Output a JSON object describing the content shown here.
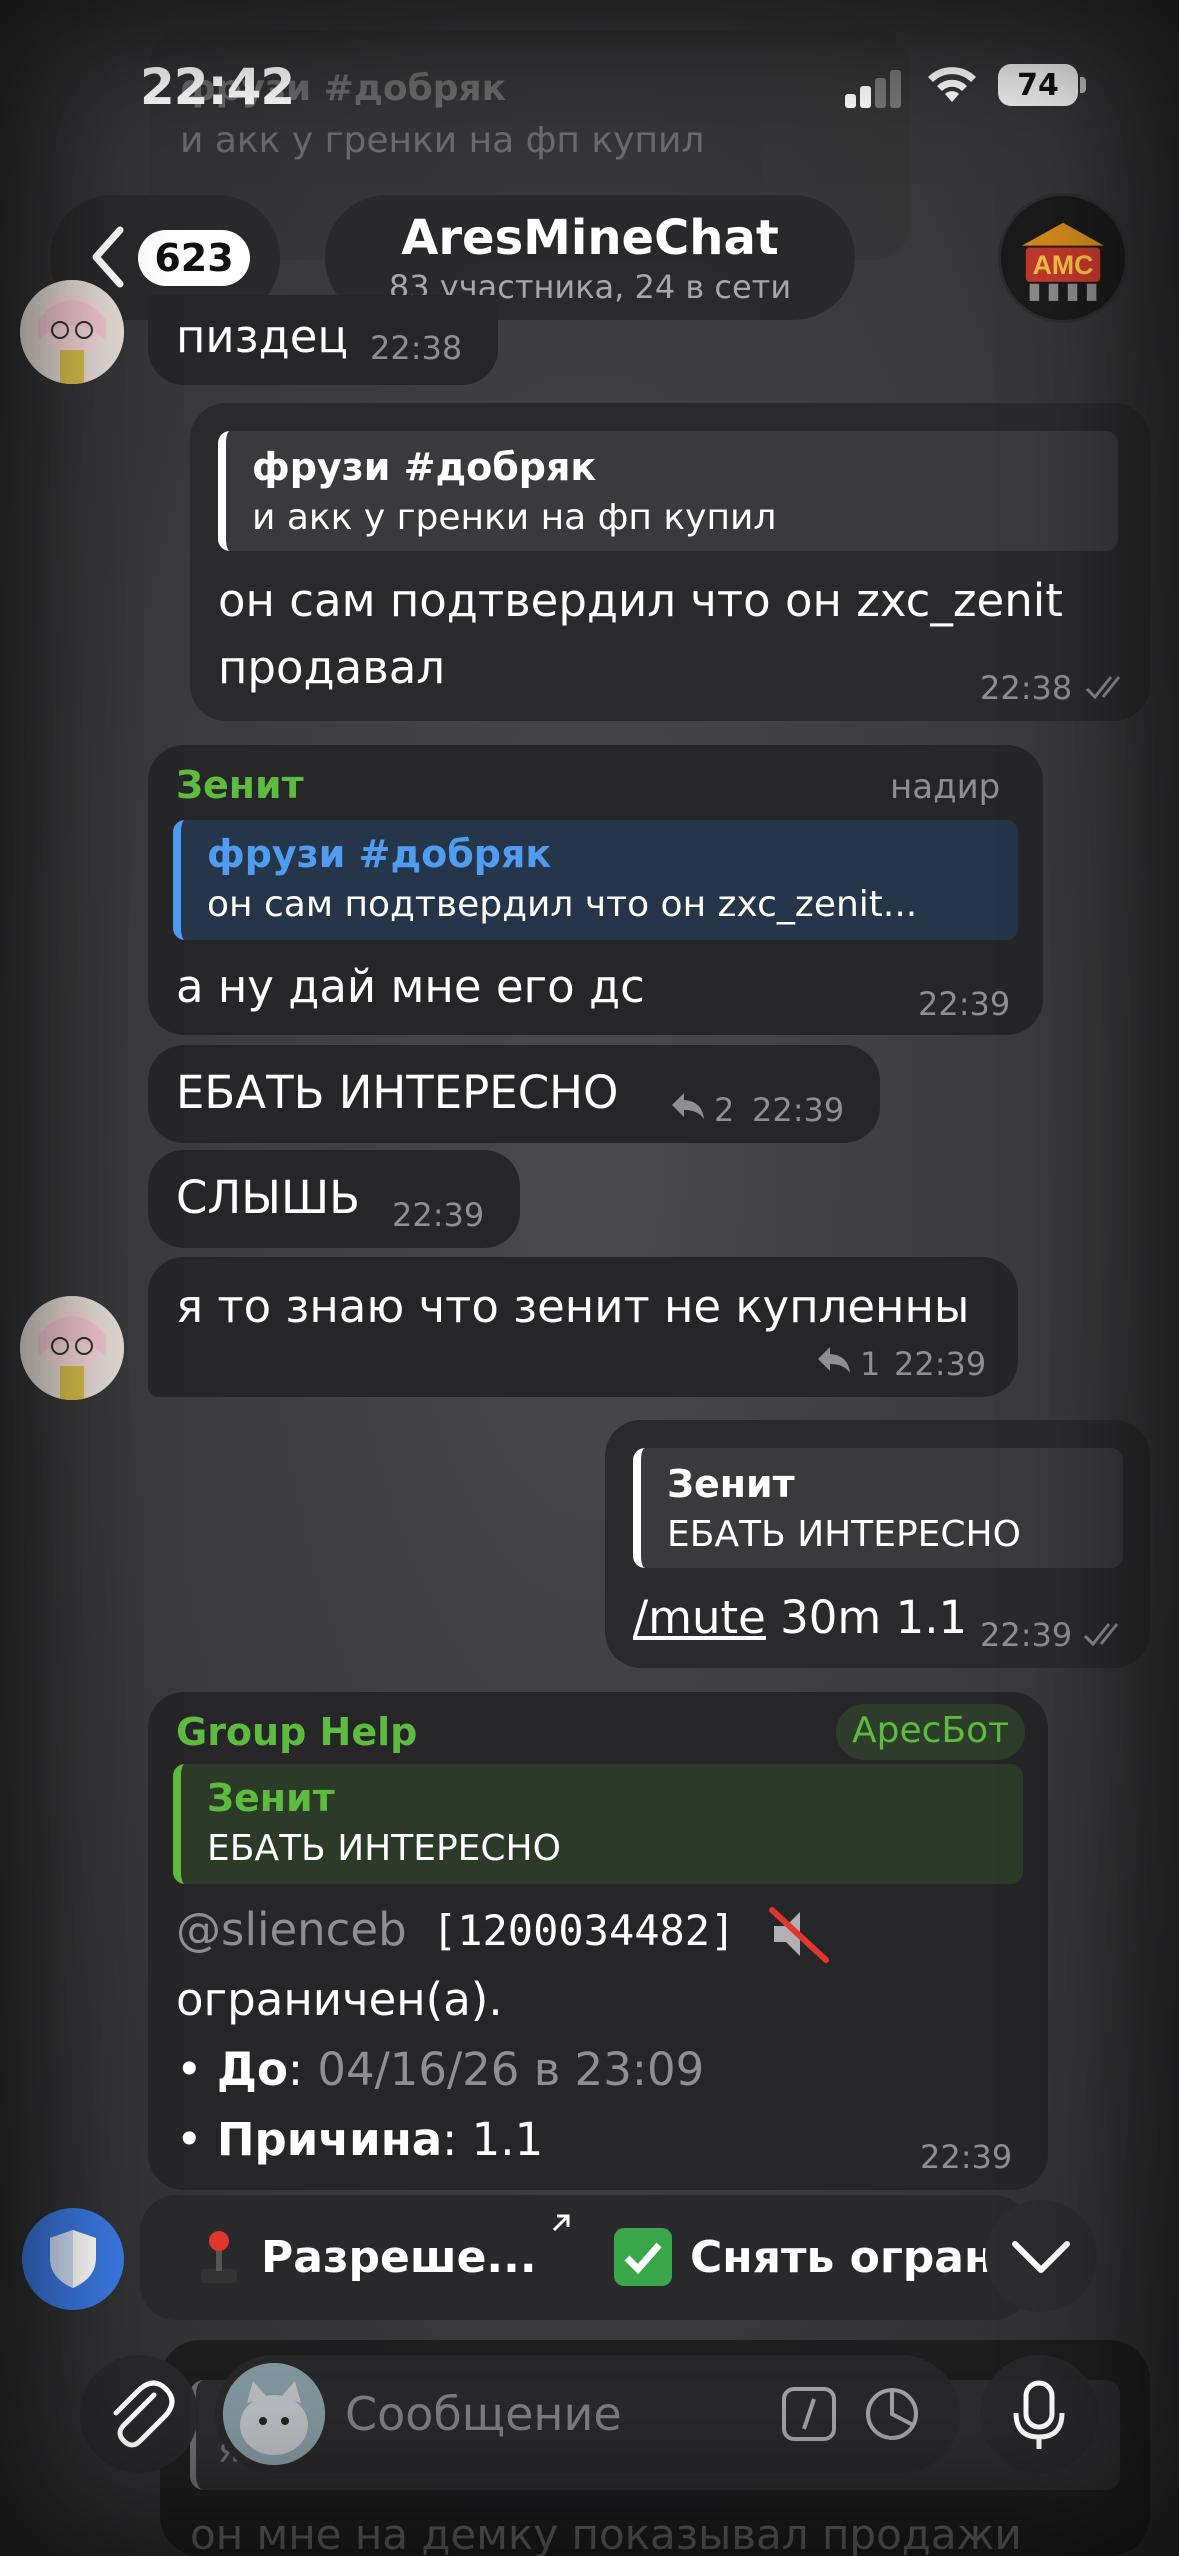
{
  "status_bar": {
    "time": "22:42",
    "battery": "74"
  },
  "background_ghost": {
    "top_quote_name": "фрузи #добряк",
    "top_quote_text": "и акк у гренки на фп купил",
    "bottom_quote_name": "я",
    "bottom_text": "он мне на демку показывал продажи"
  },
  "header": {
    "unread_count": "623",
    "title": "AresMineChat",
    "subtitle": "83 участника, 24 в сети",
    "avatar_label": "AMC"
  },
  "messages": {
    "m1": {
      "text": "пиздец",
      "time": "22:38"
    },
    "m2": {
      "quote_name": "фрузи #добряк",
      "quote_text": "и акк у гренки на фп купил",
      "text_line1": "он сам подтвердил что он zxc_zenit",
      "text_line2": "продавал",
      "time": "22:38"
    },
    "m3": {
      "sender": "Зенит",
      "tag": "надир",
      "quote_name": "фрузи #добряк",
      "quote_text": "он сам подтвердил что он zxc_zenit...",
      "text": "а ну дай мне его дс",
      "time": "22:39"
    },
    "m4": {
      "text": "ЕБАТЬ ИНТЕРЕСНО",
      "replies": "2",
      "time": "22:39"
    },
    "m5": {
      "text": "СЛЫШЬ",
      "time": "22:39"
    },
    "m6": {
      "text": "я то знаю что зенит не купленны",
      "replies": "1",
      "time": "22:39"
    },
    "m7": {
      "quote_name": "Зенит",
      "quote_text": "ЕБАТЬ ИНТЕРЕСНО",
      "command": "/mute",
      "args": " 30m 1.1",
      "time": "22:39"
    },
    "m8": {
      "sender": "Group Help",
      "tag": "АресБот",
      "quote_name": "Зенит",
      "quote_text": "ЕБАТЬ ИНТЕРЕСНО",
      "mention": "@slienceb",
      "user_id": " [1200034482] ",
      "line2": "ограничен(а).",
      "until_label": "До",
      "until_value": "04/16/26 в 23:09",
      "reason_label": "Причина",
      "reason_value": " 1.1",
      "time": "22:39"
    }
  },
  "keyboard": {
    "button1": "Разреше...",
    "button2": "Снять огран"
  },
  "composer": {
    "placeholder": "Сообщение"
  },
  "colors": {
    "accent_green": "#5dbb3f",
    "quote_blue": "#4f9cf0",
    "link_blue": "#6ab0f3"
  }
}
